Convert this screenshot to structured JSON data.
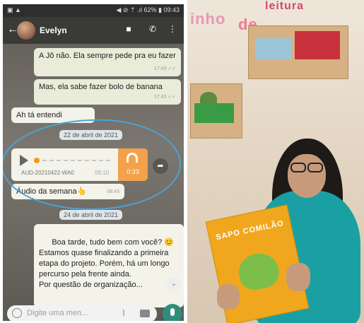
{
  "phone": {
    "status_left": "▣ ▲",
    "status_right": "◀ ⊘ ⇡ .ıl 62% ▮ 09:43",
    "contact_name": "Evelyn",
    "messages": [
      {
        "text": "A Jô não.  Ela sempre pede pra eu fazer",
        "time": "17:43 ✓✓"
      },
      {
        "text": "Mas, ela sabe fazer bolo de banana",
        "time": "17:43 ✓✓"
      },
      {
        "text": "Ah tá entendi",
        "time": ""
      }
    ],
    "date_1": "22 de abril de 2021",
    "audio": {
      "file_name": "AUD-20210422-WA0",
      "duration": "0:33",
      "time": "09:10"
    },
    "caption": {
      "text": "Áudio da semana👆",
      "time": "08:43"
    },
    "date_2": "24 de abril de 2021",
    "long_message": "Boa tarde, tudo bem com você? 😊\nEstamos quase finalizando a primeira etapa do projeto. Porém, há um longo percurso pela frente ainda.\nPor questão de organização...",
    "input_placeholder": "Digite uma men...",
    "icons": {
      "back": "arrow-left-icon",
      "video": "video-call-icon",
      "call": "phone-icon",
      "menu": "more-vert-icon",
      "emoji": "emoji-icon",
      "attach": "paperclip-icon",
      "camera": "camera-icon",
      "mic": "microphone-icon"
    }
  },
  "photo": {
    "banner_left": "inho",
    "banner_mid": "de",
    "banner_top": "leitura",
    "book_title": "SAPO COMILÃO"
  },
  "colors": {
    "annotation_oval": "#4aa3d6",
    "audio_accent": "#f3a14b",
    "mic_button": "#2f8e7b",
    "shirt": "#1aa0a2",
    "book": "#f1a71d"
  }
}
